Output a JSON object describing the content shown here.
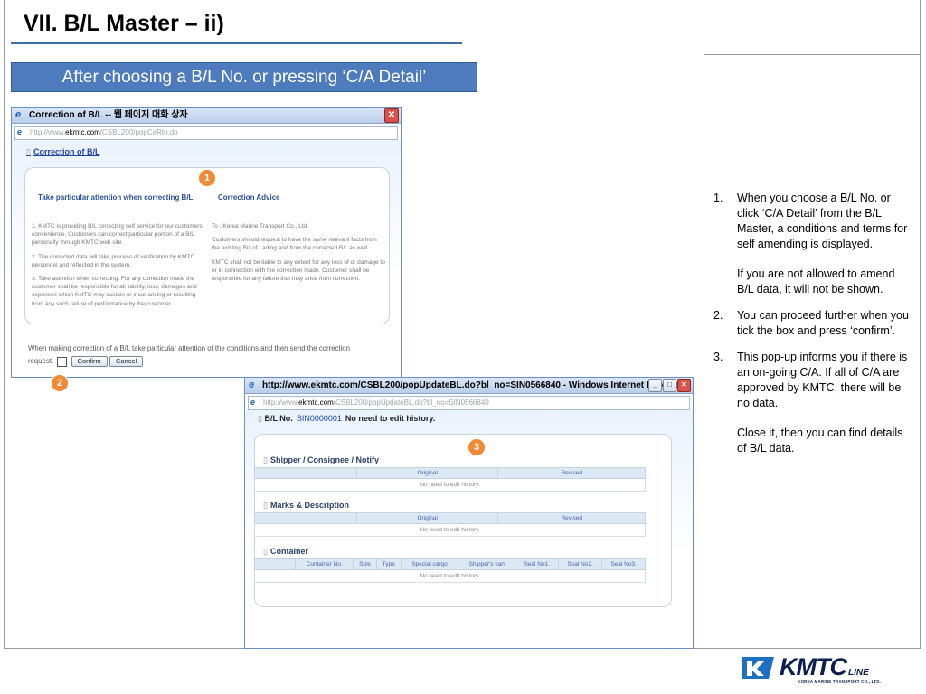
{
  "slide": {
    "title": "VII. B/L Master – ii)",
    "banner": "After choosing a B/L No. or pressing ‘C/A Detail’"
  },
  "popup1": {
    "window_title": "Correction of B/L -- 웹 페이지 대화 상자",
    "address_prefix": "http://www.",
    "address_host": "ekmtc.com",
    "address_path": "/CSBL200/popCaRtn.do",
    "section_title": "Correction of B/L",
    "marker": "1",
    "left_heading": "Take particular attention when correcting B/L",
    "right_heading": "Correction Advice",
    "left_paragraphs": [
      "1. KMTC is providing B/L correcting self service for our customers convenience. Customers can correct particular portion of a B/L personally through KMTC web site.",
      "2. The corrected data will take process of verification by KMTC personnel and reflected in the system.",
      "3. Take attention when correcting. For any correction made the customer shall be responsible for all liability, loss, damages and expenses which KMTC may sustain or incur arising or resulting from any such failure of performance by the customer."
    ],
    "right_paragraphs": [
      "To : Korea Marine Transport Co., Ltd.",
      "Customers should request to have the same relevant facts from the existing Bill of Lading and from the corrected B/L as well.",
      "KMTC shall not be liable to any extent for any loss of or damage to or in connection with the correction made. Customer shall be responsible for any failure that may arise from correction."
    ],
    "footer_text": "When making correction of a B/L take particular attention of the conditions and then send the correction",
    "request_label": "request.",
    "confirm_label": "Confirm",
    "cancel_label": "Cancel",
    "marker2": "2"
  },
  "popup2": {
    "window_title": "http://www.ekmtc.com/CSBL200/popUpdateBL.do?bl_no=SIN0566840 - Windows Internet Explorer",
    "address_prefix": "http://www.",
    "address_host": "ekmtc.com",
    "address_path": "/CSBL200/popUpdateBL.do?bl_no=SIN0566840",
    "bl_label": "B/L No.",
    "bl_number": "SIN0000001",
    "bl_message": "No need to edit history.",
    "marker": "3",
    "sections": [
      {
        "title": "Shipper / Consignee / Notify",
        "headers": [
          "",
          "Original",
          "Revised"
        ],
        "empty": "No need to edit history."
      },
      {
        "title": "Marks & Description",
        "headers": [
          "",
          "Original",
          "Revised"
        ],
        "empty": "No need to edit history."
      },
      {
        "title": "Container",
        "headers": [
          "",
          "Container No.",
          "Size",
          "Type",
          "Special cargo",
          "Shipper's van",
          "Seal No1.",
          "Seal No2.",
          "Seal No3."
        ],
        "empty": "No need to edit history."
      }
    ]
  },
  "notes": [
    {
      "num": "1.",
      "paras": [
        "When you choose a B/L No. or click ‘C/A Detail’ from the B/L Master, a conditions and terms for self amending is displayed.",
        "If you are not allowed to amend B/L data, it will not be shown."
      ]
    },
    {
      "num": "2.",
      "paras": [
        "You can proceed further when you tick the box and press ‘confirm’."
      ]
    },
    {
      "num": "3.",
      "paras": [
        "This pop-up informs you if there is an on-going C/A. If all of C/A are approved by KMTC, there will be no data.",
        "Close it, then you can find details of B/L data."
      ]
    }
  ],
  "logo": {
    "word": "KMTC",
    "suffix": "LINE",
    "subtitle": "KOREA MARINE TRANSPORT CO., LTD.",
    "colors": {
      "navy": "#0d1f4f",
      "blue": "#1f6fc0"
    }
  },
  "colors": {
    "banner": "#4d7bbd",
    "rule": "#3e6aa8",
    "marker": "#f08a34"
  }
}
